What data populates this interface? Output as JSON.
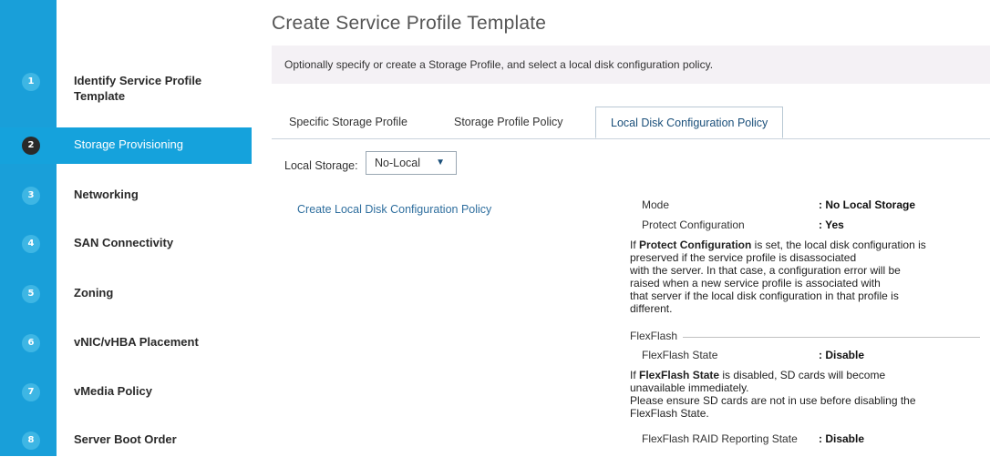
{
  "wizard": {
    "title": "Create Service Profile Template",
    "steps": [
      {
        "num": "1",
        "label_line1": "Identify Service Profile",
        "label_line2": "Template"
      },
      {
        "num": "2",
        "label": "Storage Provisioning"
      },
      {
        "num": "3",
        "label": "Networking"
      },
      {
        "num": "4",
        "label": "SAN Connectivity"
      },
      {
        "num": "5",
        "label": "Zoning"
      },
      {
        "num": "6",
        "label": "vNIC/vHBA Placement"
      },
      {
        "num": "7",
        "label": "vMedia Policy"
      },
      {
        "num": "8",
        "label": "Server Boot Order"
      }
    ],
    "active_step": 2
  },
  "info": "Optionally specify or create a Storage Profile, and select a local disk configuration policy.",
  "tabs": [
    "Specific Storage Profile",
    "Storage Profile Policy",
    "Local Disk Configuration Policy"
  ],
  "local_storage": {
    "label": "Local Storage:",
    "value": "No-Local"
  },
  "create_link": "Create Local Disk Configuration Policy",
  "details": {
    "mode_label": "Mode",
    "mode_value": ": No Local Storage",
    "protect_label": "Protect Configuration",
    "protect_value": ": Yes",
    "protect_note_bold": "Protect Configuration",
    "protect_note_pre": "If ",
    "protect_note_l1": " is set, the local disk configuration is",
    "protect_note_l2": "preserved if the service profile is disassociated",
    "protect_note_l3": "with the server. In that case, a configuration error will be",
    "protect_note_l4": "raised when a new service profile is associated with",
    "protect_note_l5": "that server if the local disk configuration in that profile is",
    "protect_note_l6": "different.",
    "flexflash_section": "FlexFlash",
    "ff_state_label": "FlexFlash State",
    "ff_state_value": ": Disable",
    "ff_note_pre": "If ",
    "ff_note_bold": "FlexFlash State",
    "ff_note_l1": " is disabled, SD cards will become",
    "ff_note_l2": "unavailable immediately.",
    "ff_note_l3": "Please ensure SD cards are not in use before disabling the",
    "ff_note_l4": "FlexFlash State.",
    "ff_raid_label": "FlexFlash RAID Reporting State",
    "ff_raid_value": ": Disable"
  },
  "colors": {
    "accent": "#15a2dc",
    "stripe": "#199fd9",
    "badge": "#3eb6e4"
  }
}
